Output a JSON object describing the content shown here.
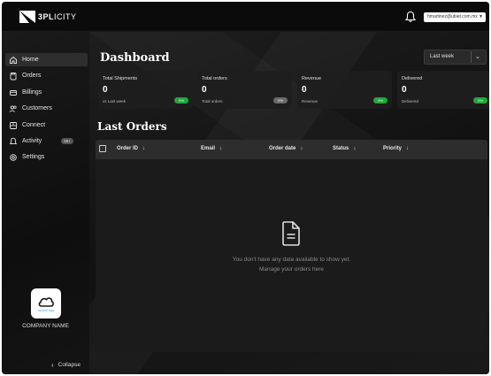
{
  "app": {
    "brand_bold": "3PL",
    "brand_light": "ICITY"
  },
  "header": {
    "user_email": "hmartinez@ubiet.com.mx"
  },
  "sidebar": {
    "items": [
      {
        "label": "Home",
        "icon": "home-icon",
        "active": true
      },
      {
        "label": "Orders",
        "icon": "orders-icon"
      },
      {
        "label": "Billings",
        "icon": "billing-icon"
      },
      {
        "label": "Customers",
        "icon": "customers-icon"
      },
      {
        "label": "Connect",
        "icon": "connect-icon"
      },
      {
        "label": "Activity",
        "icon": "bell-icon",
        "badge": "99+"
      },
      {
        "label": "Settings",
        "icon": "settings-icon"
      }
    ],
    "company_logo_text": "Upload logo",
    "company_name": "COMPANY NAME",
    "collapse_label": "Collapse"
  },
  "dashboard": {
    "title": "Dashboard",
    "range": "Last week",
    "cards": [
      {
        "title": "Total Shipments",
        "value": "0",
        "sub": "vs Last week",
        "change": "0%",
        "color": "#1fa83a"
      },
      {
        "title": "Total orders",
        "value": "0",
        "sub": "Total orders",
        "change": "0%",
        "color": "#6a6a6a"
      },
      {
        "title": "Revenue",
        "value": "0",
        "sub": "Revenue",
        "change": "0%",
        "color": "#1fa83a"
      },
      {
        "title": "Delivered",
        "value": "0",
        "sub": "Delivered",
        "change": "0%",
        "color": "#1fa83a"
      }
    ]
  },
  "orders": {
    "title": "Last Orders",
    "columns": [
      "Order ID",
      "Email",
      "Order date",
      "Status",
      "Priority"
    ],
    "sort_glyph": "↓",
    "empty_line1": "You don't have any data available to show yet.",
    "empty_line2": "Manage your orders here"
  },
  "colors": {
    "background": "#111111",
    "accent_green": "#1fa83a",
    "card": "#1e1e1e"
  }
}
